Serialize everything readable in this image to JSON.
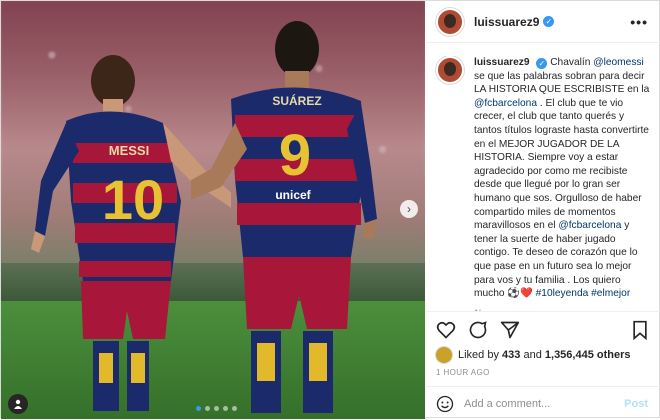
{
  "header": {
    "username": "luissuarez9",
    "verified_mark": "✓",
    "more_label": "•••"
  },
  "caption": {
    "username": "luissuarez9",
    "segments": [
      {
        "t": "Chavalín ",
        "link": false
      },
      {
        "t": "@leomessi",
        "link": true
      },
      {
        "t": " se que las palabras sobran para decir LA HISTORIA QUE ESCRIBISTE en la ",
        "link": false
      },
      {
        "t": "@fcbarcelona",
        "link": true
      },
      {
        "t": " . El club que te vio crecer, el club que tanto querés y tantos títulos lograste hasta convertirte en el MEJOR JUGADOR DE LA HISTORIA. Siempre voy a estar agradecido por como me recibiste desde que llegué por lo gran ser humano que sos. Orgulloso de haber compartido miles de momentos maravillosos en el ",
        "link": false
      },
      {
        "t": "@fcbarcelona",
        "link": true
      },
      {
        "t": " y tener la suerte de haber jugado contigo. Te deseo de corazón que lo que pase en un futuro sea lo mejor para vos y tu familia . Los quiero mucho ⚽❤️ ",
        "link": false
      },
      {
        "t": "#10leyenda",
        "link": true
      },
      {
        "t": " ",
        "link": false
      },
      {
        "t": "#elmejor",
        "link": true
      }
    ],
    "age": "1h"
  },
  "photo": {
    "jersey_left_name": "MESSI",
    "jersey_left_number": "10",
    "jersey_right_name": "SUÁREZ",
    "jersey_right_number": "9",
    "sponsor": "unicef",
    "carousel_total": 5,
    "carousel_active": 0
  },
  "likes": {
    "prefix": "Liked by",
    "user": "433",
    "joiner": "and",
    "count": "1,356,445 others"
  },
  "timestamp": "1 HOUR AGO",
  "comment": {
    "placeholder": "Add a comment...",
    "post_label": "Post"
  },
  "colors": {
    "link": "#00376b",
    "verified": "#3897f0",
    "barca_blue": "#1b2a6b",
    "barca_red": "#a8173a",
    "heart": "#ed4956"
  }
}
